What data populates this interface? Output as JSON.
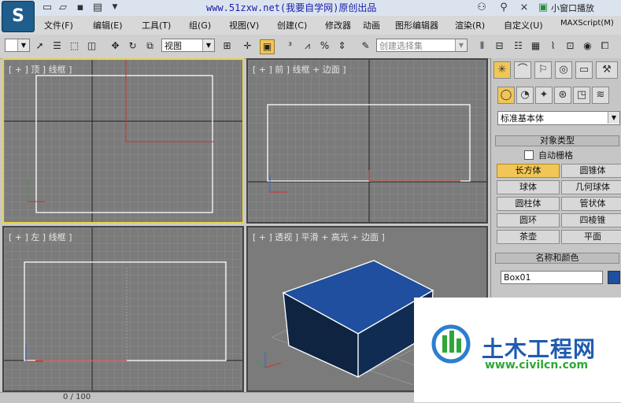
{
  "titlebar": {
    "watermark": "www.51zxw.net(我要自学网)原创出品",
    "player_label": "小窗口播放",
    "logo_letter": "S"
  },
  "menubar": {
    "items": [
      "文件(F)",
      "编辑(E)",
      "工具(T)",
      "组(G)",
      "视图(V)",
      "创建(C)",
      "修改器",
      "动画",
      "图形编辑器",
      "渲染(R)",
      "自定义(U)",
      "MAXScript(M)"
    ]
  },
  "toolbar": {
    "reference_coord": "视图",
    "selection_set_placeholder": "创建选择集"
  },
  "viewports": {
    "top": "[ + ] 顶 ] 线框 ]",
    "front": "[ + ] 前 ] 线框 + 边面 ]",
    "left": "[ + ] 左 ] 线框 ]",
    "perspective": "[ + ] 透视 ] 平滑 + 高光 + 边面 ]"
  },
  "command_panel": {
    "category": "标准基本体",
    "object_type_header": "对象类型",
    "autogrid_label": "自动栅格",
    "buttons": [
      "长方体",
      "圆锥体",
      "球体",
      "几何球体",
      "圆柱体",
      "管状体",
      "圆环",
      "四棱锥",
      "茶壶",
      "平面"
    ],
    "active_button": "长方体",
    "name_color_header": "名称和颜色",
    "object_name": "Box01",
    "object_color": "#1f4f9e"
  },
  "overlay_logo": {
    "name": "土木工程网",
    "url": "www.civilcn.com"
  },
  "status": {
    "frame": "0 / 100"
  }
}
